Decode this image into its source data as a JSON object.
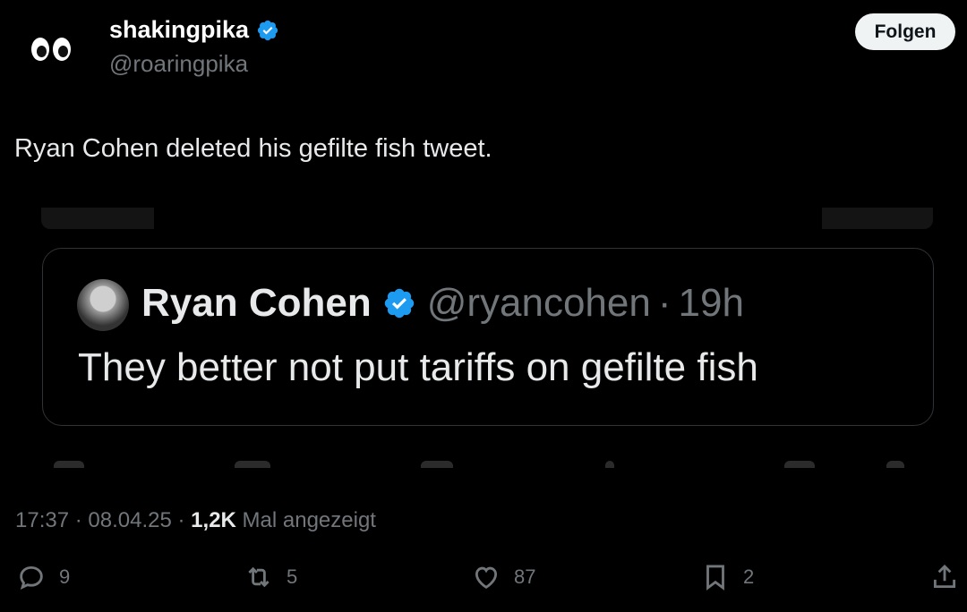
{
  "user": {
    "avatar_icon": "eyes-emoji-icon",
    "display_name": "shakingpika",
    "handle": "@roaringpika",
    "verified": true
  },
  "follow_label": "Folgen",
  "tweet_text": "Ryan Cohen deleted his gefilte fish tweet.",
  "quoted": {
    "display_name": "Ryan Cohen",
    "handle": "@ryancohen",
    "separator": "·",
    "age": "19h",
    "text": "They better not put tariffs on gefilte fish",
    "verified": true
  },
  "meta": {
    "time": "17:37",
    "date": "08.04.25",
    "views_count": "1,2K",
    "views_label": "Mal angezeigt"
  },
  "actions": {
    "replies": "9",
    "reposts": "5",
    "likes": "87",
    "bookmarks": "2"
  },
  "colors": {
    "background": "#000000",
    "verified_badge": "#1d9bf0",
    "text_primary": "#e7e9ea",
    "text_secondary": "#71767b"
  }
}
